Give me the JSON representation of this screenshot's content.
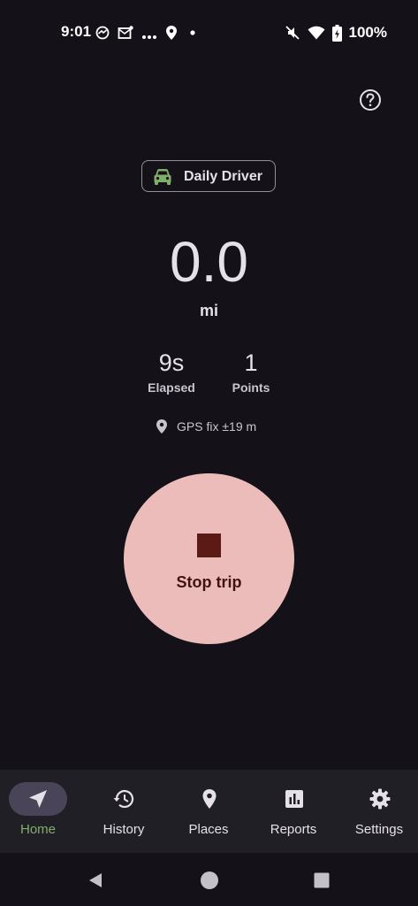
{
  "status_bar": {
    "time": "9:01",
    "left_icons": [
      "messenger-icon",
      "mail-icon",
      "more-dots-icon",
      "location-icon",
      "dot-icon"
    ],
    "right_icons": [
      "mute-icon",
      "wifi-icon",
      "battery-charging-icon"
    ],
    "battery_percent": "100%"
  },
  "header": {
    "help_icon": "help-icon"
  },
  "vehicle": {
    "name": "Daily Driver",
    "icon": "car-icon",
    "icon_color": "#7fae6a"
  },
  "trip": {
    "distance": "0.0",
    "unit": "mi",
    "elapsed_value": "9s",
    "elapsed_label": "Elapsed",
    "points_value": "1",
    "points_label": "Points",
    "gps_text": "GPS fix ±19 m"
  },
  "stop_button": {
    "label": "Stop trip",
    "bg_color": "#ebbcba",
    "icon_color": "#5b1a15"
  },
  "bottom_nav": {
    "items": [
      {
        "label": "Home",
        "icon": "navigation-arrow-icon",
        "active": true
      },
      {
        "label": "History",
        "icon": "history-icon",
        "active": false
      },
      {
        "label": "Places",
        "icon": "place-pin-icon",
        "active": false
      },
      {
        "label": "Reports",
        "icon": "bar-chart-icon",
        "active": false
      },
      {
        "label": "Settings",
        "icon": "gear-icon",
        "active": false
      }
    ],
    "active_color": "#7fae6a"
  },
  "system_nav": {
    "icons": [
      "back-icon",
      "home-icon",
      "recents-icon"
    ]
  }
}
